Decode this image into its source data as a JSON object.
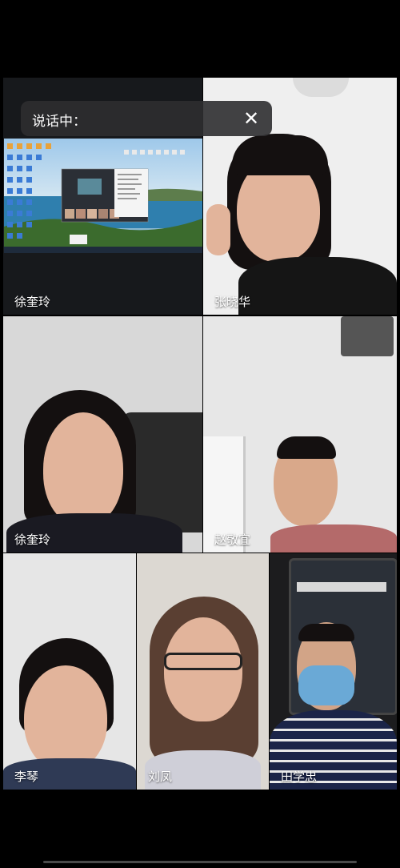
{
  "banner": {
    "speaking_label": "说话中：",
    "close_icon": "close-icon"
  },
  "participants": [
    {
      "name": "徐奎玲"
    },
    {
      "name": "张晓华"
    },
    {
      "name": "徐奎玲"
    },
    {
      "name": "赵敬宜"
    },
    {
      "name": "李琴"
    },
    {
      "name": "刘凤"
    },
    {
      "name": "田学忠"
    }
  ],
  "colors": {
    "background": "#000000",
    "banner": "#2d2d30",
    "label": "#ffffff"
  }
}
